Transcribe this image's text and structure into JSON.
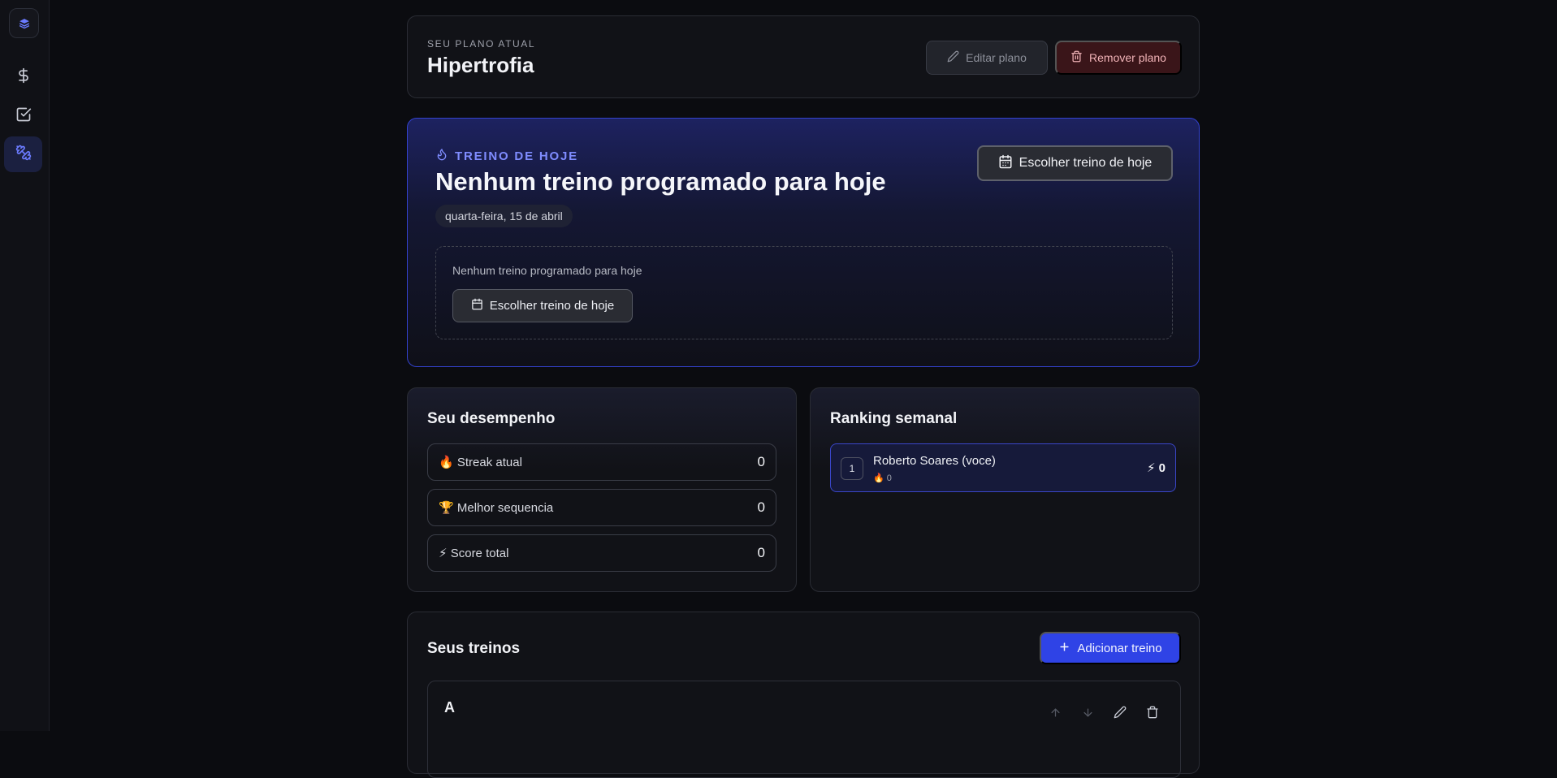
{
  "plan": {
    "eyebrow": "SEU PLANO ATUAL",
    "title": "Hipertrofia",
    "edit_label": "Editar plano",
    "remove_label": "Remover plano"
  },
  "today": {
    "eyebrow": "TREINO DE HOJE",
    "title": "Nenhum treino programado para hoje",
    "date": "quarta-feira, 15 de abril",
    "choose_label": "Escolher treino de hoje",
    "empty_text": "Nenhum treino programado para hoje",
    "empty_choose_label": "Escolher treino de hoje"
  },
  "performance": {
    "title": "Seu desempenho",
    "stats": [
      {
        "emoji": "🔥",
        "label": "Streak atual",
        "value": "0"
      },
      {
        "emoji": "🏆",
        "label": "Melhor sequencia",
        "value": "0"
      },
      {
        "emoji": "⚡",
        "label": "Score total",
        "value": "0"
      }
    ]
  },
  "ranking": {
    "title": "Ranking semanal",
    "rows": [
      {
        "position": "1",
        "name": "Roberto Soares (voce)",
        "streak": "🔥 0",
        "score": "⚡ 0"
      }
    ]
  },
  "treinos": {
    "title": "Seus treinos",
    "add_label": "Adicionar treino",
    "items": [
      {
        "name": "A"
      }
    ]
  },
  "colors": {
    "accent": "#2f43e6",
    "accent_text": "#7f8cff",
    "danger_bg": "#3a1519",
    "background": "#0b0c10"
  },
  "icons": {
    "sidebar": [
      "app-logo-icon",
      "dollar-icon",
      "checkbox-icon",
      "dumbbell-icon"
    ]
  }
}
